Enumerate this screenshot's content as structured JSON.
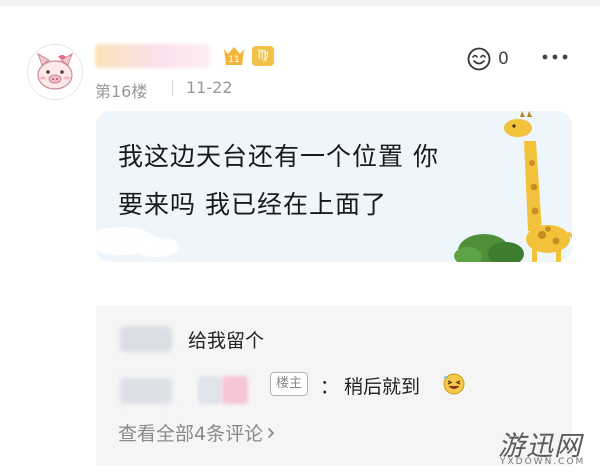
{
  "post": {
    "floor": "第16楼",
    "time": "11-22",
    "like_count": "0",
    "level_badge": "11",
    "zodiac_badge": "♍",
    "content_line1": "我这边天台还有一个位置 你",
    "content_line2": "要来吗 我已经在上面了"
  },
  "replies": {
    "items": [
      {
        "text": "给我留个"
      },
      {
        "op_badge": "楼主",
        "colon": "：",
        "text": "稍后就到"
      }
    ],
    "view_all": "查看全部4条评论"
  },
  "watermark": {
    "main": "游迅网",
    "sub": "YXDOWN.COM"
  },
  "colors": {
    "bubble_bg": "#eef5fb",
    "replies_bg": "#f5f5f5",
    "meta_text": "#999999",
    "giraffe": "#f2c23b"
  },
  "icons": {
    "avatar": "pig-avatar",
    "like": "like-face-icon",
    "more": "more-dots-icon",
    "view_all_chevron": "chevron-right-icon",
    "emoji": "grin-emoji-icon"
  }
}
